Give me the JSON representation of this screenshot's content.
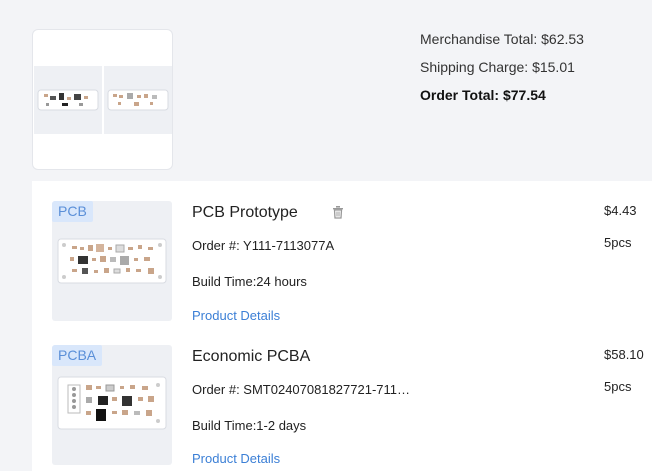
{
  "summary": {
    "merchandise_total": "Merchandise Total: $62.53",
    "shipping_charge": "Shipping Charge: $15.01",
    "order_total": "Order Total: $77.54"
  },
  "items": [
    {
      "tag": "PCB",
      "title": "PCB Prototype",
      "order_number": "Order #: Y111-7113077A",
      "build_time": "Build Time:24 hours",
      "details_link": "Product Details",
      "price": "$4.43",
      "quantity": "5pcs"
    },
    {
      "tag": "PCBA",
      "title": "Economic PCBA",
      "order_number": "Order #: SMT02407081827721-711…",
      "build_time": "Build Time:1-2 days",
      "details_link": "Product Details",
      "price": "$58.10",
      "quantity": "5pcs"
    }
  ],
  "colors": {
    "background": "#f3f4f7",
    "card": "#ffffff",
    "link": "#3b7fd6",
    "tag_bg": "#d9e7fb",
    "tag_text": "#5a8fd8"
  },
  "icons": {
    "delete": "trash-icon"
  }
}
